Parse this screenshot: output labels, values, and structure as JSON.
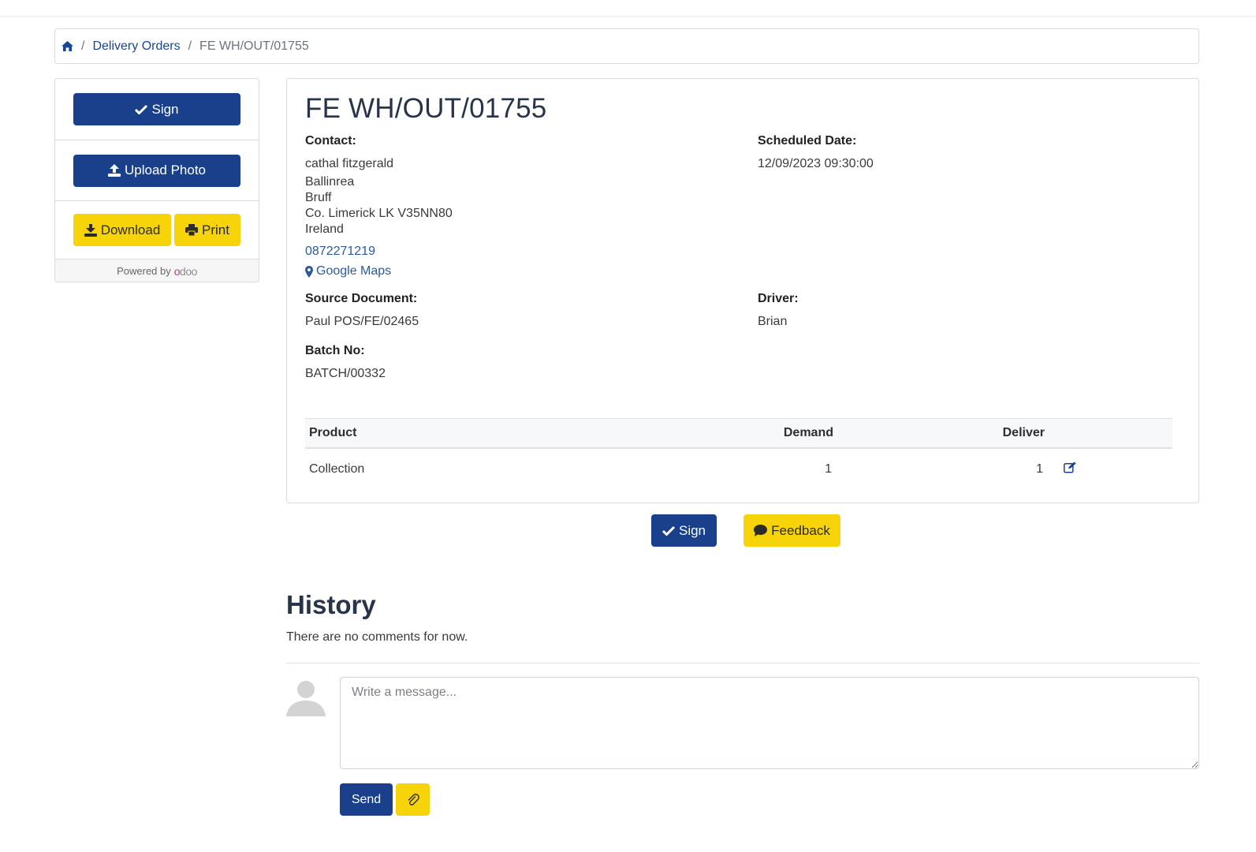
{
  "colors": {
    "primary": "#1a408c",
    "accent_yellow": "#f7d40a",
    "link": "#2d5a9c",
    "heading": "#28344a",
    "odoo_purple": "#a24689"
  },
  "breadcrumb": {
    "home_icon": "home-icon",
    "items": [
      "Delivery Orders",
      "FE WH/OUT/01755"
    ]
  },
  "sidebar": {
    "sign_label": "Sign",
    "upload_label": "Upload Photo",
    "download_label": "Download",
    "print_label": "Print",
    "powered_by": "Powered by",
    "brand_o": "o",
    "brand_rest": "doo"
  },
  "order": {
    "title": "FE WH/OUT/01755",
    "contact_label": "Contact:",
    "contact_name": "cathal fitzgerald",
    "address": [
      "Ballinrea",
      "Bruff",
      "Co. Limerick LK V35NN80",
      "Ireland"
    ],
    "phone": "0872271219",
    "maps_label": "Google Maps",
    "scheduled_label": "Scheduled Date:",
    "scheduled_value": "12/09/2023 09:30:00",
    "source_label": "Source Document:",
    "source_value": "Paul POS/FE/02465",
    "driver_label": "Driver:",
    "driver_value": "Brian",
    "batch_label": "Batch No:",
    "batch_value": "BATCH/00332"
  },
  "table": {
    "headers": [
      "Product",
      "Demand",
      "Deliver"
    ],
    "rows": [
      {
        "product": "Collection",
        "demand": "1",
        "deliver": "1"
      }
    ]
  },
  "actions": {
    "sign_label": "Sign",
    "feedback_label": "Feedback"
  },
  "history": {
    "title": "History",
    "empty_text": "There are no comments for now.",
    "message_placeholder": "Write a message...",
    "send_label": "Send"
  }
}
